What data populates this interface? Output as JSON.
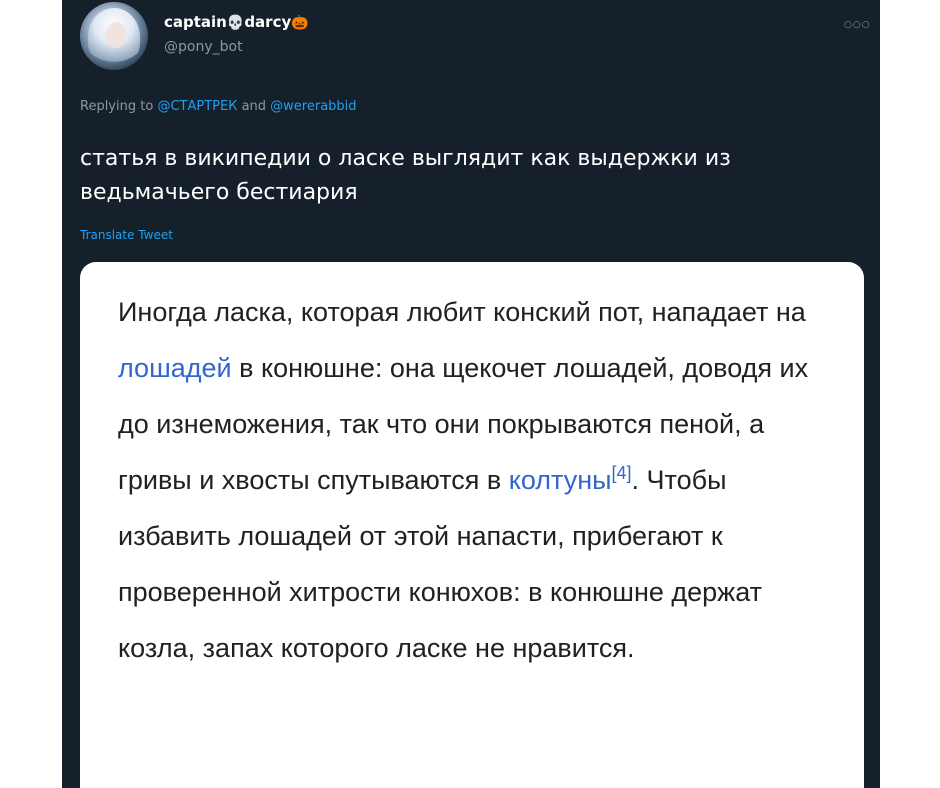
{
  "user": {
    "display_name": "captain",
    "display_name_suffix": "darcy",
    "icons": [
      "skull-emoji",
      "pumpkin-emoji"
    ],
    "handle": "@pony_bot"
  },
  "reply": {
    "prefix": "Replying to",
    "mention_1": "@СТАРТРЕК",
    "conjunction": "and",
    "mention_2": "@wererabbid"
  },
  "tweet": {
    "text": "статья в википедии о ласке выглядит как выдержки из ведьмачьего бестиария",
    "translate_label": "Translate Tweet"
  },
  "quote": {
    "part1": "Иногда ласка, которая любит конский пот, нападает на ",
    "link1": "лошадей",
    "part2": " в конюшне: она щекочет лошадей, доводя их до изнеможения, так что они покрываются пеной, а гривы и хвосты спутываются в ",
    "link2": "колтуны",
    "ref": "[4]",
    "part3": ". Чтобы избавить лошадей от этой напасти, прибегают к проверенной хитрости конюхов: в конюшне держат козла, запах которого ласке не нравится."
  },
  "colors": {
    "background": "#15202b",
    "accent": "#1da1f2",
    "secondary_text": "#8899a6",
    "wiki_link": "#3366cc"
  }
}
